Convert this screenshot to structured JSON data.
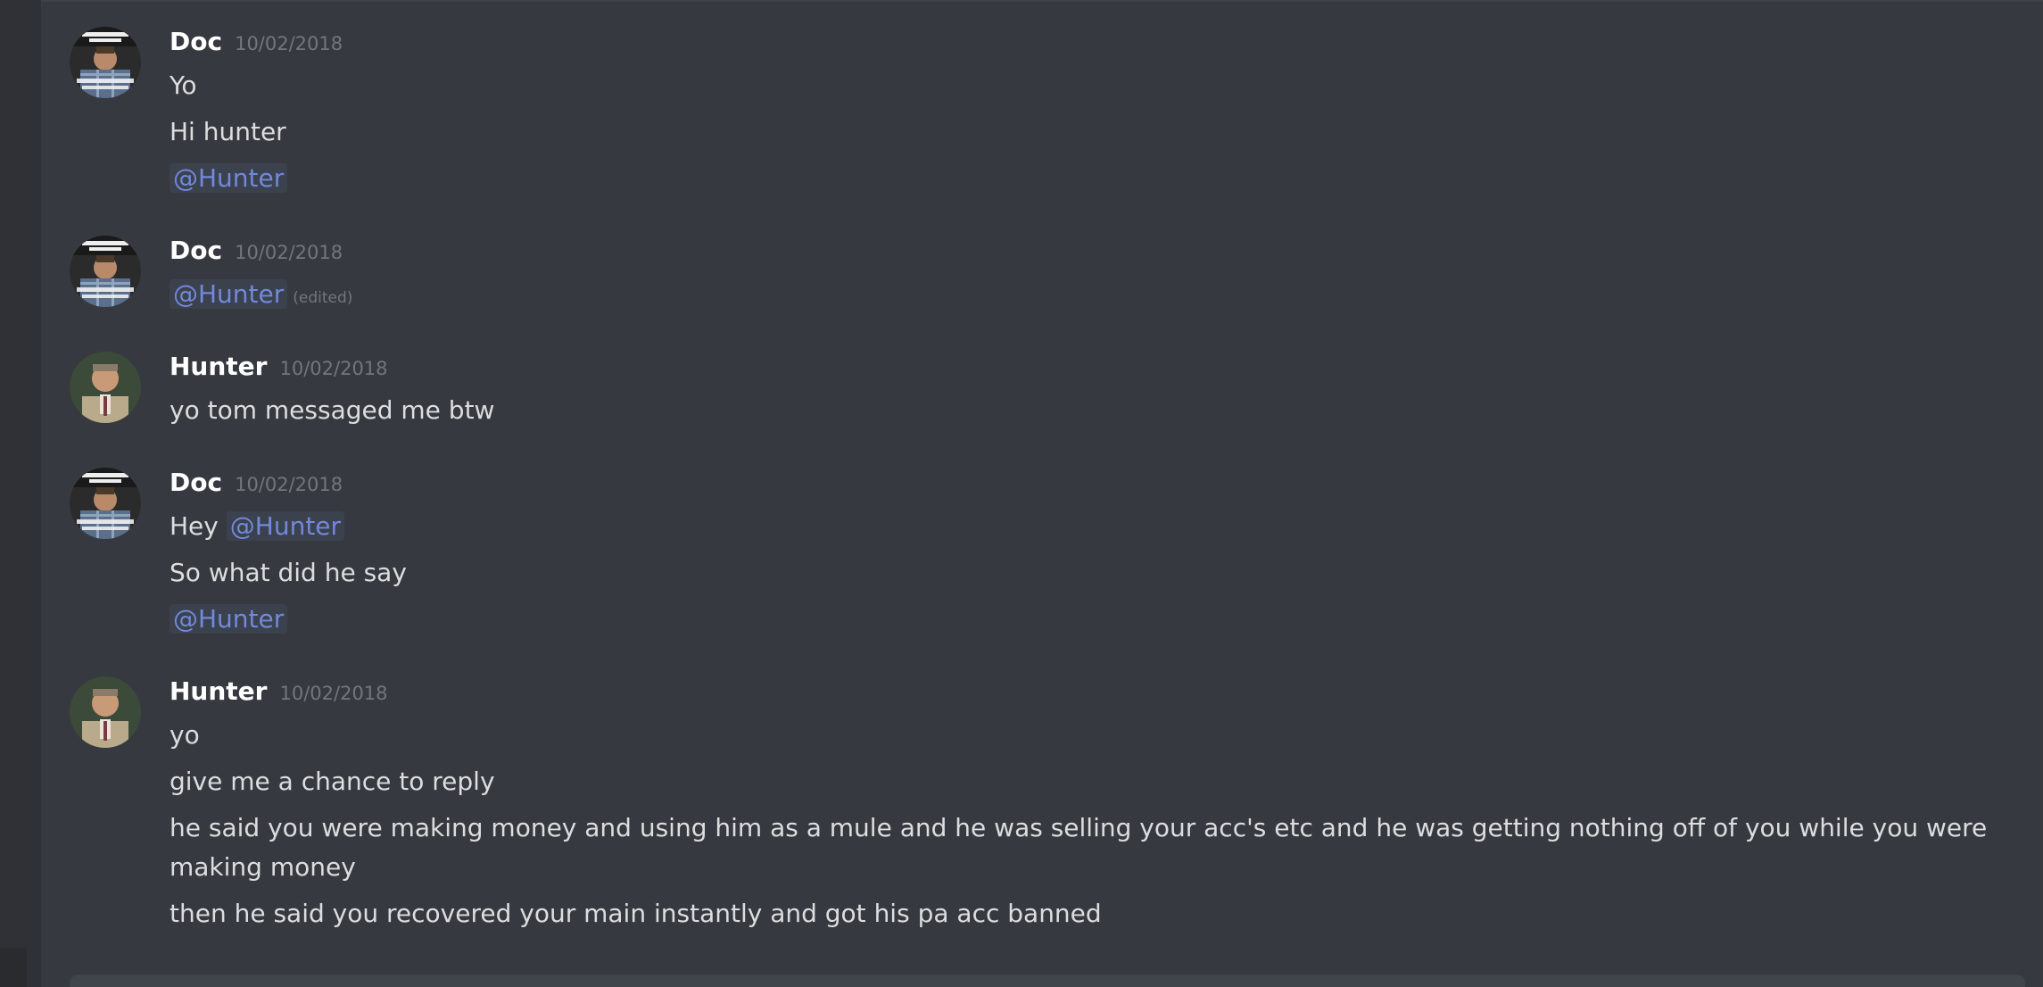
{
  "colors": {
    "background": "#36393f",
    "username": "#ffffff",
    "timestamp": "#72767d",
    "text": "#dcddde",
    "mention": "#7289da"
  },
  "messages": [
    {
      "author": "Doc",
      "timestamp": "10/02/2018",
      "avatar_icon": "doc-avatar",
      "lines": [
        "Yo",
        "Hi hunter",
        "@Hunter"
      ]
    },
    {
      "author": "Doc",
      "timestamp": "10/02/2018",
      "avatar_icon": "doc-avatar",
      "lines": [
        "@Hunter"
      ],
      "edited_label": "(edited)"
    },
    {
      "author": "Hunter",
      "timestamp": "10/02/2018",
      "avatar_icon": "hunter-avatar",
      "lines": [
        "yo tom messaged me btw"
      ]
    },
    {
      "author": "Doc",
      "timestamp": "10/02/2018",
      "avatar_icon": "doc-avatar",
      "lines": [
        "Hey",
        "@Hunter",
        "So what did he say",
        "@Hunter"
      ]
    },
    {
      "author": "Hunter",
      "timestamp": "10/02/2018",
      "avatar_icon": "hunter-avatar",
      "lines": [
        "yo",
        "give me a chance to reply",
        "he said you were making money and using him as a mule and he was selling your acc's etc and he was getting nothing off of you while you were making money",
        "then he said you recovered your main instantly and got his pa acc banned"
      ]
    }
  ]
}
